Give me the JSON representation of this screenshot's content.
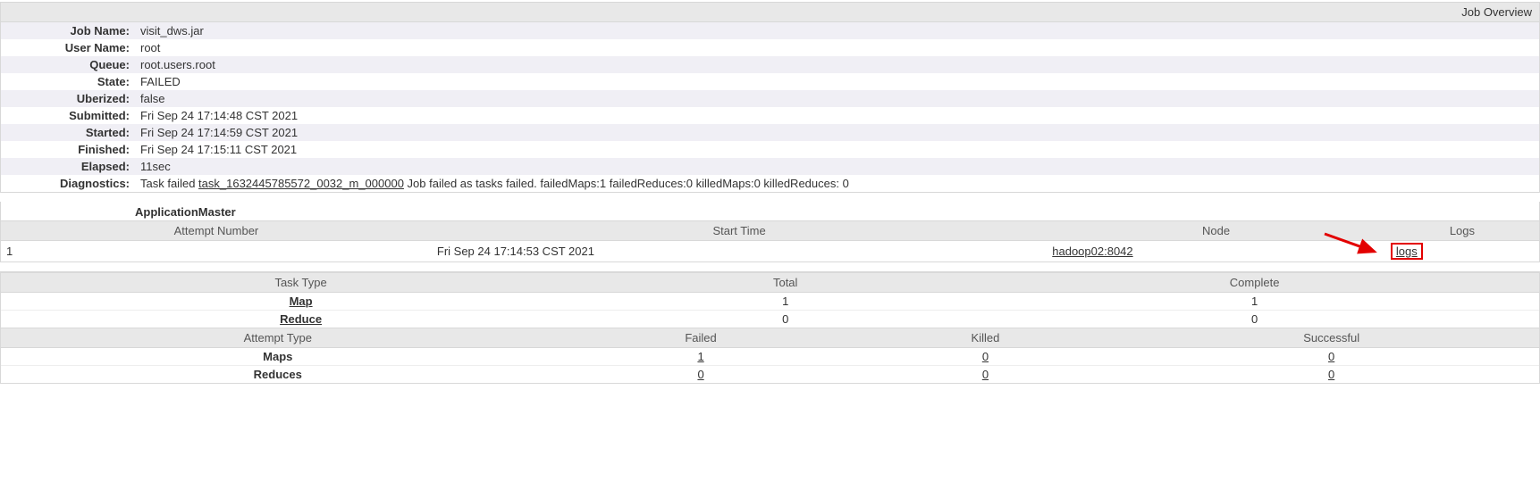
{
  "overview": {
    "title": "Job Overview",
    "rows": {
      "job_name": {
        "label": "Job Name:",
        "value": "visit_dws.jar"
      },
      "user_name": {
        "label": "User Name:",
        "value": "root"
      },
      "queue": {
        "label": "Queue:",
        "value": "root.users.root"
      },
      "state": {
        "label": "State:",
        "value": "FAILED"
      },
      "uberized": {
        "label": "Uberized:",
        "value": "false"
      },
      "submitted": {
        "label": "Submitted:",
        "value": "Fri Sep 24 17:14:48 CST 2021"
      },
      "started": {
        "label": "Started:",
        "value": "Fri Sep 24 17:14:59 CST 2021"
      },
      "finished": {
        "label": "Finished:",
        "value": "Fri Sep 24 17:15:11 CST 2021"
      },
      "elapsed": {
        "label": "Elapsed:",
        "value": "11sec"
      },
      "diagnostics": {
        "label": "Diagnostics:",
        "prefix": "Task failed ",
        "task_link": "task_1632445785572_0032_m_000000",
        "suffix": " Job failed as tasks failed. failedMaps:1 failedReduces:0 killedMaps:0 killedReduces: 0"
      }
    }
  },
  "app_master": {
    "title": "ApplicationMaster",
    "headers": {
      "attempt": "Attempt Number",
      "start": "Start Time",
      "node": "Node",
      "logs": "Logs"
    },
    "row": {
      "attempt": "1",
      "start": "Fri Sep 24 17:14:53 CST 2021",
      "node": "hadoop02:8042",
      "logs": "logs"
    }
  },
  "task_type": {
    "headers": {
      "type": "Task Type",
      "total": "Total",
      "complete": "Complete"
    },
    "map": {
      "label": "Map",
      "total": "1",
      "complete": "1"
    },
    "reduce": {
      "label": "Reduce",
      "total": "0",
      "complete": "0"
    }
  },
  "attempt_type": {
    "headers": {
      "type": "Attempt Type",
      "failed": "Failed",
      "killed": "Killed",
      "successful": "Successful"
    },
    "maps": {
      "label": "Maps",
      "failed": "1",
      "killed": "0",
      "successful": "0"
    },
    "reduces": {
      "label": "Reduces",
      "failed": "0",
      "killed": "0",
      "successful": "0"
    }
  }
}
